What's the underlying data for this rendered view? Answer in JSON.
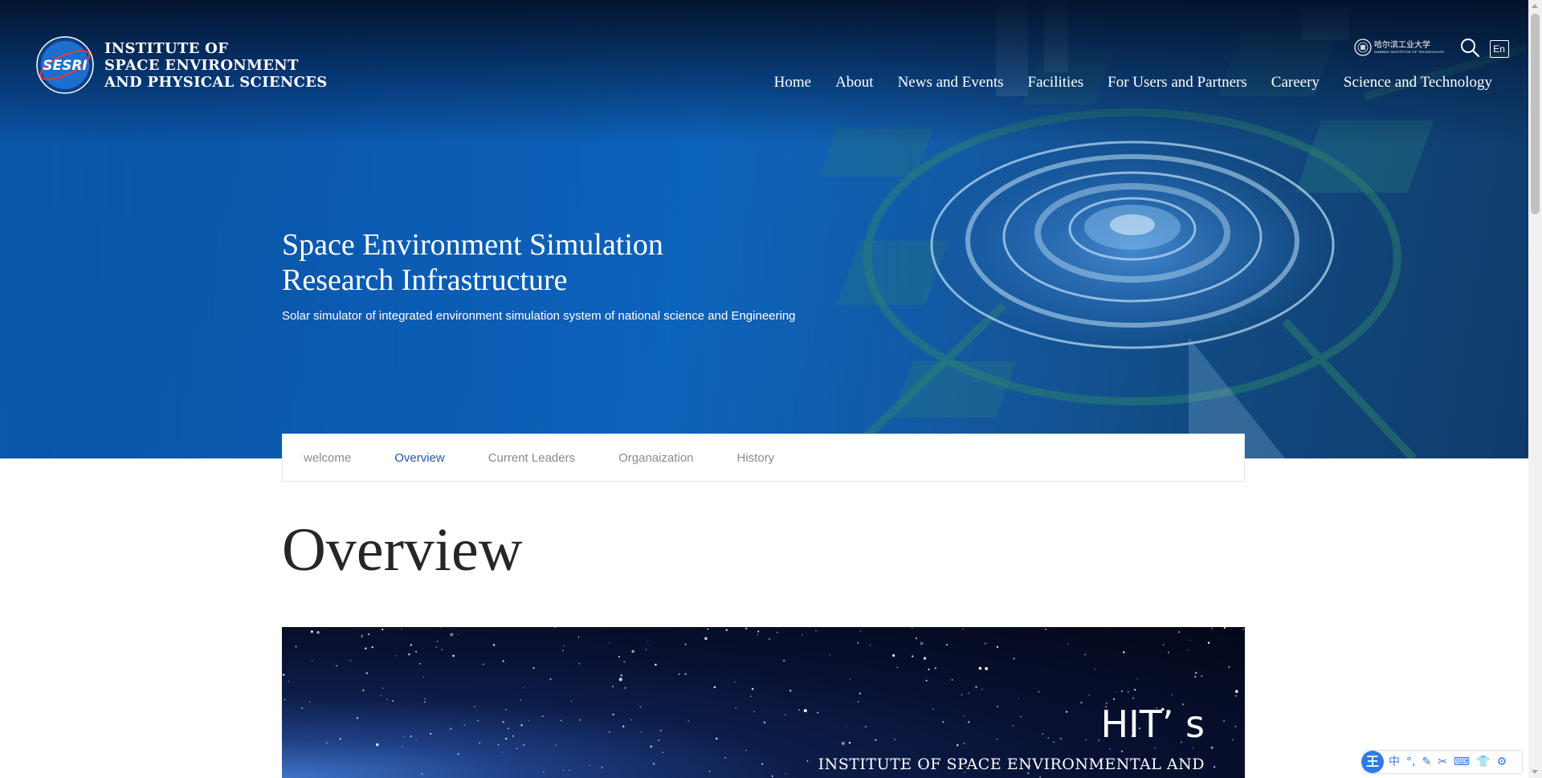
{
  "header": {
    "logo_emblem_text": "SESRI",
    "logo_lines": [
      "INSTITUTE OF",
      "SPACE ENVIRONMENT",
      "AND PHYSICAL SCIENCES"
    ],
    "university_name": "哈尔滨工业大学",
    "university_sub": "HARBIN INSTITUTE OF TECHNOLOGY",
    "lang_label": "En",
    "nav": [
      "Home",
      "About",
      "News and Events",
      "Facilities",
      "For Users and Partners",
      "Careery",
      "Science and Technology"
    ]
  },
  "hero": {
    "title_lines": [
      "Space Environment Simulation",
      "Research Infrastructure"
    ],
    "subtitle": "Solar simulator of integrated environment simulation system of national science and Engineering"
  },
  "sub_nav": {
    "tabs": [
      "welcome",
      "Overview",
      "Current Leaders",
      "Organaization",
      "History"
    ],
    "active": "Overview"
  },
  "section": {
    "heading": "Overview"
  },
  "banner": {
    "hit": "HIT’ s",
    "institute": "INSTITUTE OF SPACE ENVIRONMENTAL AND"
  },
  "ime": {
    "logo": "王",
    "items": [
      "中",
      "°,",
      "✎",
      "✂",
      "⌨",
      "👕",
      "⚙"
    ]
  },
  "colors": {
    "hero_blue": "#0b5bb2",
    "active_tab": "#1c5aa8",
    "heading": "#262626",
    "ime_blue": "#2d7be5"
  }
}
